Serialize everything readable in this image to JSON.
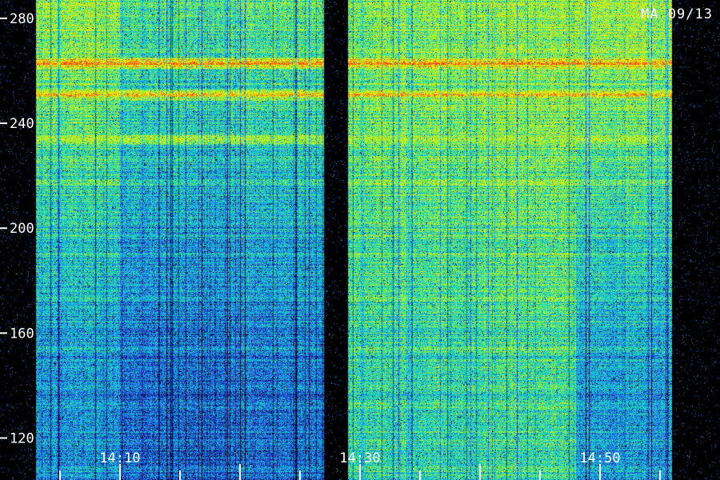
{
  "chart_data": {
    "type": "heatmap",
    "label": "MA 09/13",
    "y_ticks": [
      {
        "value": 120,
        "label": "120"
      },
      {
        "value": 160,
        "label": "160"
      },
      {
        "value": 200,
        "label": "200"
      },
      {
        "value": 240,
        "label": "240"
      },
      {
        "value": 280,
        "label": "280"
      }
    ],
    "y_range": [
      104,
      287
    ],
    "x_tick_labels": [
      {
        "time": "14:10",
        "label": "14:10"
      },
      {
        "time": "14:30",
        "label": "14:30"
      },
      {
        "time": "14:50",
        "label": "14:50"
      }
    ],
    "x_range": [
      "14:00",
      "15:00"
    ],
    "minor_x_tick_interval_min": 5,
    "colorscale": [
      "#000000",
      "#0a1a7a",
      "#2a4fd8",
      "#12b8e8",
      "#28e0a0",
      "#b8f020",
      "#f8f000",
      "#ff3010"
    ],
    "data_gaps": [
      [
        "14:00",
        "14:03"
      ],
      [
        "14:27",
        "14:29"
      ],
      [
        "14:56",
        "15:00"
      ]
    ],
    "segments": [
      {
        "start": "14:03",
        "end": "14:10",
        "low_level": 0.4,
        "high_level": 0.7
      },
      {
        "start": "14:10",
        "end": "14:20",
        "low_level": 0.33,
        "high_level": 0.6
      },
      {
        "start": "14:20",
        "end": "14:27",
        "low_level": 0.35,
        "high_level": 0.63
      },
      {
        "start": "14:29",
        "end": "14:31",
        "low_level": 0.55,
        "high_level": 0.65
      },
      {
        "start": "14:31",
        "end": "14:40",
        "low_level": 0.55,
        "high_level": 0.68
      },
      {
        "start": "14:40",
        "end": "14:48",
        "low_level": 0.58,
        "high_level": 0.7
      },
      {
        "start": "14:48",
        "end": "14:56",
        "low_level": 0.42,
        "high_level": 0.72
      }
    ],
    "bright_bands": [
      {
        "frequency": 263,
        "level": 0.95
      },
      {
        "frequency": 251,
        "level": 0.85
      },
      {
        "frequency": 234,
        "level": 0.78
      }
    ]
  }
}
